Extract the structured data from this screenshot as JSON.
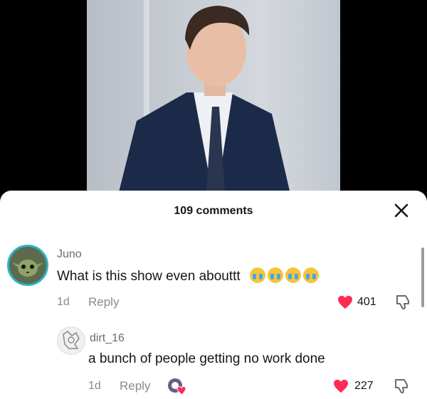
{
  "comments_header": {
    "title": "109 comments"
  },
  "comments": [
    {
      "username": "Juno",
      "text": "What is this show even abouttt",
      "emoji_count": 4,
      "age": "1d",
      "reply_label": "Reply",
      "likes": "401"
    },
    {
      "username": "dirt_16",
      "text": "a bunch of people getting no work done",
      "age": "1d",
      "reply_label": "Reply",
      "likes": "227"
    }
  ],
  "colors": {
    "heart": "#fe2c55",
    "avatar_ring": "#2db3c4"
  }
}
